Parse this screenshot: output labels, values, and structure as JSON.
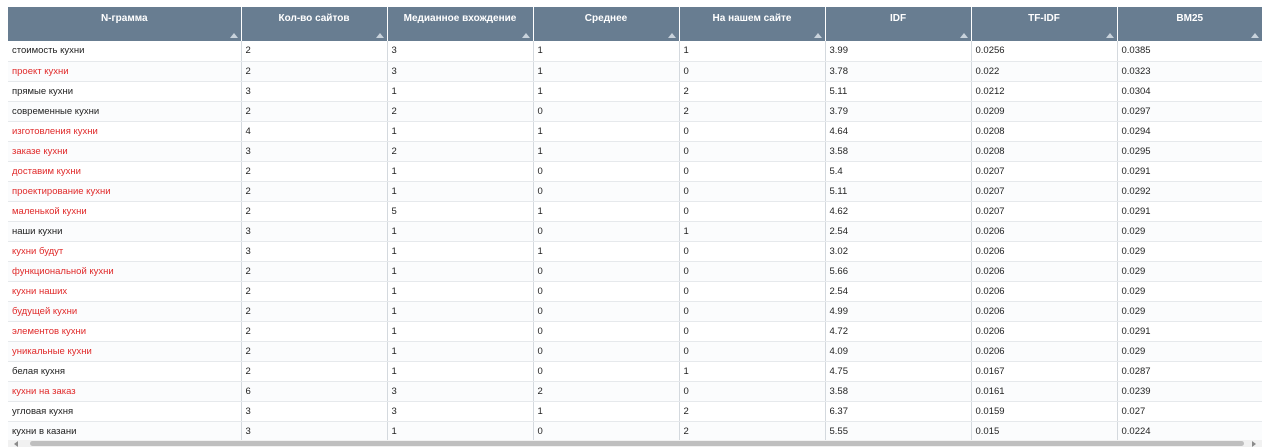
{
  "table": {
    "columns": [
      "N-грамма",
      "Кол-во сайтов",
      "Медианное вхождение",
      "Среднее",
      "На нашем сайте",
      "IDF",
      "TF-IDF",
      "BM25"
    ],
    "highlight_color": "#e02a2a",
    "header_color": "#687d91",
    "rows": [
      {
        "ngram": "стоимость кухни",
        "highlighted": false,
        "sites": "2",
        "median": "3",
        "mean": "1",
        "ours": "1",
        "idf": "3.99",
        "tfidf": "0.0256",
        "bm25": "0.0385"
      },
      {
        "ngram": "проект кухни",
        "highlighted": true,
        "sites": "2",
        "median": "3",
        "mean": "1",
        "ours": "0",
        "idf": "3.78",
        "tfidf": "0.022",
        "bm25": "0.0323"
      },
      {
        "ngram": "прямые кухни",
        "highlighted": false,
        "sites": "3",
        "median": "1",
        "mean": "1",
        "ours": "2",
        "idf": "5.11",
        "tfidf": "0.0212",
        "bm25": "0.0304"
      },
      {
        "ngram": "современные кухни",
        "highlighted": false,
        "sites": "2",
        "median": "2",
        "mean": "0",
        "ours": "2",
        "idf": "3.79",
        "tfidf": "0.0209",
        "bm25": "0.0297"
      },
      {
        "ngram": "изготовления кухни",
        "highlighted": true,
        "sites": "4",
        "median": "1",
        "mean": "1",
        "ours": "0",
        "idf": "4.64",
        "tfidf": "0.0208",
        "bm25": "0.0294"
      },
      {
        "ngram": "заказе кухни",
        "highlighted": true,
        "sites": "3",
        "median": "2",
        "mean": "1",
        "ours": "0",
        "idf": "3.58",
        "tfidf": "0.0208",
        "bm25": "0.0295"
      },
      {
        "ngram": "доставим кухни",
        "highlighted": true,
        "sites": "2",
        "median": "1",
        "mean": "0",
        "ours": "0",
        "idf": "5.4",
        "tfidf": "0.0207",
        "bm25": "0.0291"
      },
      {
        "ngram": "проектирование кухни",
        "highlighted": true,
        "sites": "2",
        "median": "1",
        "mean": "0",
        "ours": "0",
        "idf": "5.11",
        "tfidf": "0.0207",
        "bm25": "0.0292"
      },
      {
        "ngram": "маленькой кухни",
        "highlighted": true,
        "sites": "2",
        "median": "5",
        "mean": "1",
        "ours": "0",
        "idf": "4.62",
        "tfidf": "0.0207",
        "bm25": "0.0291"
      },
      {
        "ngram": "наши кухни",
        "highlighted": false,
        "sites": "3",
        "median": "1",
        "mean": "0",
        "ours": "1",
        "idf": "2.54",
        "tfidf": "0.0206",
        "bm25": "0.029"
      },
      {
        "ngram": "кухни будут",
        "highlighted": true,
        "sites": "3",
        "median": "1",
        "mean": "1",
        "ours": "0",
        "idf": "3.02",
        "tfidf": "0.0206",
        "bm25": "0.029"
      },
      {
        "ngram": "функциональной кухни",
        "highlighted": true,
        "sites": "2",
        "median": "1",
        "mean": "0",
        "ours": "0",
        "idf": "5.66",
        "tfidf": "0.0206",
        "bm25": "0.029"
      },
      {
        "ngram": "кухни наших",
        "highlighted": true,
        "sites": "2",
        "median": "1",
        "mean": "0",
        "ours": "0",
        "idf": "2.54",
        "tfidf": "0.0206",
        "bm25": "0.029"
      },
      {
        "ngram": "будущей кухни",
        "highlighted": true,
        "sites": "2",
        "median": "1",
        "mean": "0",
        "ours": "0",
        "idf": "4.99",
        "tfidf": "0.0206",
        "bm25": "0.029"
      },
      {
        "ngram": "элементов кухни",
        "highlighted": true,
        "sites": "2",
        "median": "1",
        "mean": "0",
        "ours": "0",
        "idf": "4.72",
        "tfidf": "0.0206",
        "bm25": "0.0291"
      },
      {
        "ngram": "уникальные кухни",
        "highlighted": true,
        "sites": "2",
        "median": "1",
        "mean": "0",
        "ours": "0",
        "idf": "4.09",
        "tfidf": "0.0206",
        "bm25": "0.029"
      },
      {
        "ngram": "белая кухня",
        "highlighted": false,
        "sites": "2",
        "median": "1",
        "mean": "0",
        "ours": "1",
        "idf": "4.75",
        "tfidf": "0.0167",
        "bm25": "0.0287"
      },
      {
        "ngram": "кухни на заказ",
        "highlighted": true,
        "sites": "6",
        "median": "3",
        "mean": "2",
        "ours": "0",
        "idf": "3.58",
        "tfidf": "0.0161",
        "bm25": "0.0239"
      },
      {
        "ngram": "угловая кухня",
        "highlighted": false,
        "sites": "3",
        "median": "3",
        "mean": "1",
        "ours": "2",
        "idf": "6.37",
        "tfidf": "0.0159",
        "bm25": "0.027"
      },
      {
        "ngram": "кухни в казани",
        "highlighted": false,
        "sites": "3",
        "median": "1",
        "mean": "0",
        "ours": "2",
        "idf": "5.55",
        "tfidf": "0.015",
        "bm25": "0.0224"
      }
    ]
  }
}
